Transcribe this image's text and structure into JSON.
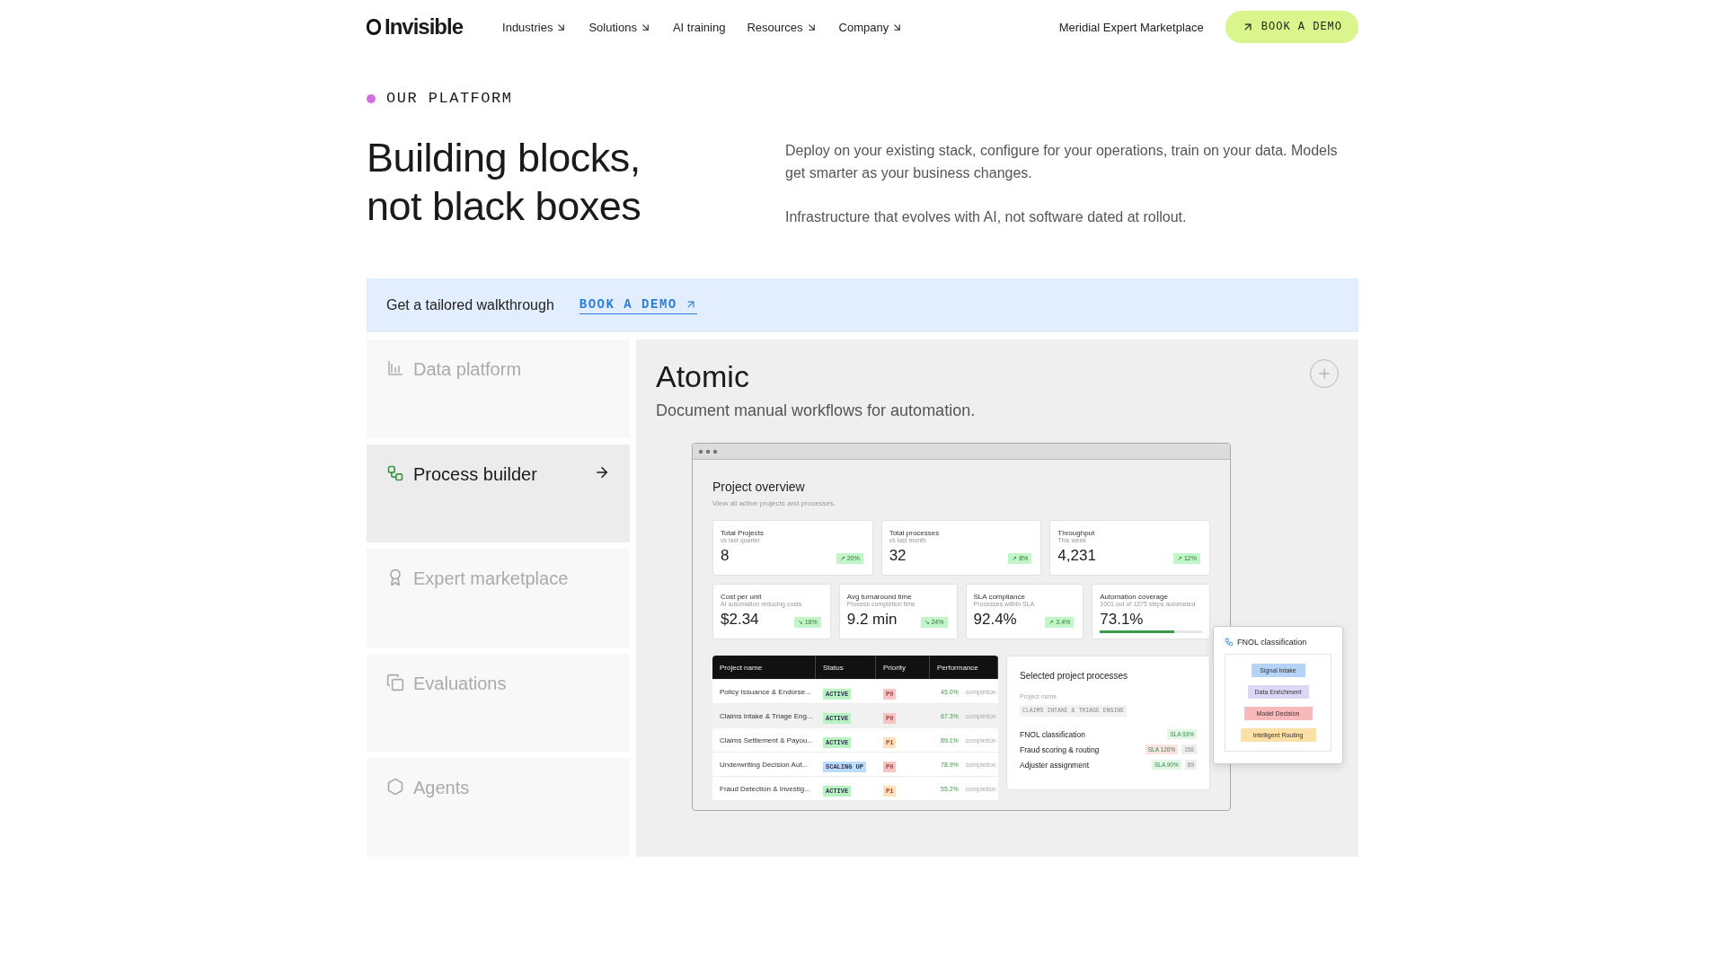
{
  "nav": {
    "logo": "Invisible",
    "items": [
      {
        "label": "Industries",
        "dropdown": true
      },
      {
        "label": "Solutions",
        "dropdown": true
      },
      {
        "label": "AI training",
        "dropdown": false
      },
      {
        "label": "Resources",
        "dropdown": true
      },
      {
        "label": "Company",
        "dropdown": true
      }
    ],
    "link": "Meridial Expert Marketplace",
    "cta": "BOOK A DEMO"
  },
  "eyebrow": {
    "label": "OUR PLATFORM",
    "color": "#d36ee0"
  },
  "hero": {
    "title": "Building blocks,\nnot black boxes",
    "paragraphs": [
      "Deploy on your existing stack, configure for your operations, train on your data. Models get smarter as your business changes.",
      "Infrastructure that evolves with AI, not software dated at rollout."
    ]
  },
  "banner": {
    "text": "Get a tailored walkthrough",
    "link": "BOOK A DEMO"
  },
  "sidebar": {
    "items": [
      {
        "label": "Data platform",
        "kind": "chart",
        "selected": false
      },
      {
        "label": "Process builder",
        "kind": "blocks",
        "selected": true
      },
      {
        "label": "Expert marketplace",
        "kind": "badge",
        "selected": false
      },
      {
        "label": "Evaluations",
        "kind": "stack",
        "selected": false
      },
      {
        "label": "Agents",
        "kind": "hexagon",
        "selected": false
      }
    ]
  },
  "detail": {
    "title": "Atomic",
    "subtitle": "Document manual workflows for automation."
  },
  "mockup": {
    "title": "Project overview",
    "subtitle": "View all active projects and processes.",
    "stats_top": [
      {
        "label": "Total Projects",
        "note": "vs last quarter",
        "value": "8",
        "delta": "↗ 20%"
      },
      {
        "label": "Total processes",
        "note": "vs last month",
        "value": "32",
        "delta": "↗ 8%"
      },
      {
        "label": "Throughput",
        "note": "This week",
        "value": "4,231",
        "delta": "↗ 12%"
      }
    ],
    "stats_bottom": [
      {
        "label": "Cost per unit",
        "note": "AI automation reducing costs",
        "value": "$2.34",
        "delta": "↘ 18%",
        "kind": "badge"
      },
      {
        "label": "Avg turnaround time",
        "note": "Process completion time",
        "value": "9.2 min",
        "delta": "↘ 24%",
        "kind": "badge"
      },
      {
        "label": "SLA compliance",
        "note": "Processes within SLA",
        "value": "92.4%",
        "delta": "↗ 3.4%",
        "kind": "badge"
      },
      {
        "label": "Automation coverage",
        "note": "1001 out of 1375 steps automated",
        "value": "73.1%",
        "level": 0.73,
        "kind": "bar"
      }
    ],
    "table": {
      "columns": [
        "Project name",
        "Status",
        "Priority",
        "Performance"
      ],
      "rows": [
        {
          "name": "Policy Issuance & Endorse...",
          "status": {
            "label": "ACTIVE",
            "color": "#b9f2c2"
          },
          "priority": {
            "label": "P0",
            "color": "#f7c4c4"
          },
          "performance": "45.0%",
          "unit": "completion",
          "selected": false
        },
        {
          "name": "Claims Intake & Triage Eng...",
          "status": {
            "label": "ACTIVE",
            "color": "#b9f2c2"
          },
          "priority": {
            "label": "P0",
            "color": "#f7c4c4"
          },
          "performance": "67.3%",
          "unit": "completion",
          "selected": true
        },
        {
          "name": "Claims Settlement & Payou...",
          "status": {
            "label": "ACTIVE",
            "color": "#b9f2c2"
          },
          "priority": {
            "label": "P1",
            "color": "#fbe2b8"
          },
          "performance": "89.1%",
          "unit": "completion",
          "selected": false
        },
        {
          "name": "Underwriting Decision Aut...",
          "status": {
            "label": "SCALING UP",
            "color": "#bcdcfb"
          },
          "priority": {
            "label": "P0",
            "color": "#f7c4c4"
          },
          "performance": "78.9%",
          "unit": "completion",
          "selected": false
        },
        {
          "name": "Fraud Detection & Investig...",
          "status": {
            "label": "ACTIVE",
            "color": "#b9f2c2"
          },
          "priority": {
            "label": "P1",
            "color": "#fbe2b8"
          },
          "performance": "55.2%",
          "unit": "completion",
          "selected": false
        }
      ]
    },
    "processes": {
      "title": "Selected project processes",
      "field_label": "Project name",
      "field_value": "CLAIMS INTAKE & TRIAGE ENGINE",
      "rows": [
        {
          "name": "FNOL classification",
          "sla": {
            "label": "SLA 93%",
            "color": "#e3f7e6"
          }
        },
        {
          "name": "Fraud scoring & routing",
          "sla": {
            "label": "SLA 120%",
            "color": "#fde2e2"
          },
          "count": "156"
        },
        {
          "name": "Adjuster assignment",
          "sla": {
            "label": "SLA 90%",
            "color": "#e3f7e6"
          },
          "count": "89"
        }
      ]
    },
    "popup": {
      "title": "FNOL classification",
      "steps": [
        {
          "label": "Signal Intake",
          "color": "#b5d3f7"
        },
        {
          "label": "Data Enrichment",
          "color": "#dcd6f7"
        },
        {
          "label": "Model Decision",
          "color": "#f7b9b9"
        },
        {
          "label": "Intelligent Routing",
          "color": "#fbe0a8"
        }
      ]
    }
  }
}
